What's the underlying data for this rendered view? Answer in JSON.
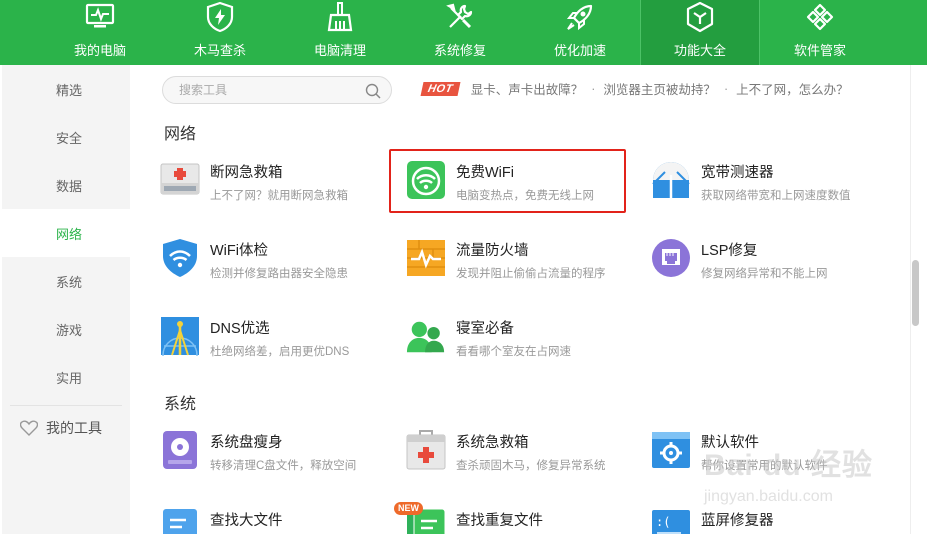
{
  "nav": {
    "items": [
      {
        "label": "我的电脑",
        "icon": "monitor-pulse-icon"
      },
      {
        "label": "木马查杀",
        "icon": "shield-bolt-icon"
      },
      {
        "label": "电脑清理",
        "icon": "broom-icon"
      },
      {
        "label": "系统修复",
        "icon": "wrench-screwdriver-icon"
      },
      {
        "label": "优化加速",
        "icon": "rocket-icon"
      },
      {
        "label": "功能大全",
        "icon": "cube-icon",
        "active": true
      },
      {
        "label": "软件管家",
        "icon": "app-grid-icon"
      }
    ]
  },
  "sidebar": {
    "items": [
      {
        "label": "精选"
      },
      {
        "label": "安全"
      },
      {
        "label": "数据"
      },
      {
        "label": "网络",
        "active": true
      },
      {
        "label": "系统"
      },
      {
        "label": "游戏"
      },
      {
        "label": "实用"
      }
    ],
    "my_tools": "我的工具"
  },
  "search": {
    "placeholder": "搜索工具",
    "value": ""
  },
  "hot": {
    "badge": "HOT",
    "links": [
      "显卡、声卡出故障？",
      "浏览器主页被劫持？",
      "上不了网，怎么办？"
    ],
    "dot": "·"
  },
  "sections": [
    {
      "title": "网络",
      "tools": [
        {
          "name": "断网急救箱",
          "desc": "上不了网？就用断网急救箱",
          "icon": "first-aid-kit-icon"
        },
        {
          "name": "免费WiFi",
          "desc": "电脑变热点，免费无线上网",
          "icon": "wifi-icon",
          "highlighted": true
        },
        {
          "name": "宽带测速器",
          "desc": "获取网络带宽和上网速度数值",
          "icon": "speedometer-icon"
        },
        {
          "name": "WiFi体检",
          "desc": "检测并修复路由器安全隐患",
          "icon": "wifi-shield-icon"
        },
        {
          "name": "流量防火墙",
          "desc": "发现并阻止偷偷占流量的程序",
          "icon": "firewall-icon"
        },
        {
          "name": "LSP修复",
          "desc": "修复网络异常和不能上网",
          "icon": "network-port-icon"
        },
        {
          "name": "DNS优选",
          "desc": "杜绝网络差，启用更优DNS",
          "icon": "dns-tower-icon"
        },
        {
          "name": "寝室必备",
          "desc": "看看哪个室友在占网速",
          "icon": "roommates-icon"
        }
      ]
    },
    {
      "title": "系统",
      "tools": [
        {
          "name": "系统盘瘦身",
          "desc": "转移清理C盘文件，释放空间",
          "icon": "disk-icon"
        },
        {
          "name": "系统急救箱",
          "desc": "查杀顽固木马，修复异常系统",
          "icon": "system-aid-icon"
        },
        {
          "name": "默认软件",
          "desc": "帮你设置常用的默认软件",
          "icon": "default-app-gear-icon"
        },
        {
          "name": "查找大文件",
          "desc": "",
          "icon": "large-file-icon"
        },
        {
          "name": "查找重复文件",
          "desc": "",
          "icon": "duplicate-file-icon",
          "badge": "NEW"
        },
        {
          "name": "蓝屏修复器",
          "desc": "",
          "icon": "bluescreen-icon"
        }
      ]
    }
  ],
  "watermark": {
    "logo": "Bai du 经验",
    "url": "jingyan.baidu.com"
  },
  "colors": {
    "brand_green": "#2bb34a",
    "active_green": "#239e3f",
    "highlight_red": "#e2231a",
    "hot_red": "#e8543f"
  }
}
